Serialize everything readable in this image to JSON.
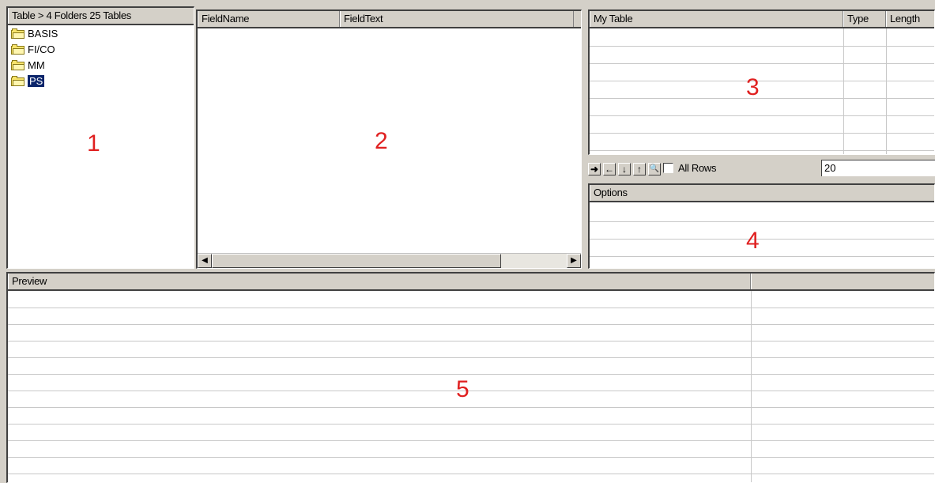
{
  "tree": {
    "header": "Table > 4 Folders 25 Tables",
    "items": [
      {
        "label": "BASIS",
        "icon": "folder-icon"
      },
      {
        "label": "FI/CO",
        "icon": "folder-icon"
      },
      {
        "label": "MM",
        "icon": "folder-icon"
      },
      {
        "label": "PS",
        "icon": "folder-icon",
        "selected": true
      }
    ]
  },
  "fields": {
    "columns": [
      "FieldName",
      "FieldText"
    ]
  },
  "mytable": {
    "columns": [
      "My Table",
      "Type",
      "Length"
    ]
  },
  "toolbar": {
    "buttons": [
      {
        "icon": "arrow-right-icon",
        "glyph": "➜"
      },
      {
        "icon": "arrow-left-icon",
        "glyph": "←"
      },
      {
        "icon": "arrow-down-icon",
        "glyph": "↓"
      },
      {
        "icon": "arrow-up-icon",
        "glyph": "↑"
      },
      {
        "icon": "preview-icon",
        "glyph": "🔍"
      }
    ],
    "all_rows_label": "All Rows",
    "all_rows_checked": false,
    "rows_value": "20"
  },
  "options": {
    "header": "Options"
  },
  "preview": {
    "header": "Preview"
  },
  "annotations": {
    "one": "1",
    "two": "2",
    "three": "3",
    "four": "4",
    "five": "5"
  },
  "colors": {
    "chrome": "#d4d0c8",
    "selection": "#0a246a",
    "annotation": "#e02020"
  }
}
